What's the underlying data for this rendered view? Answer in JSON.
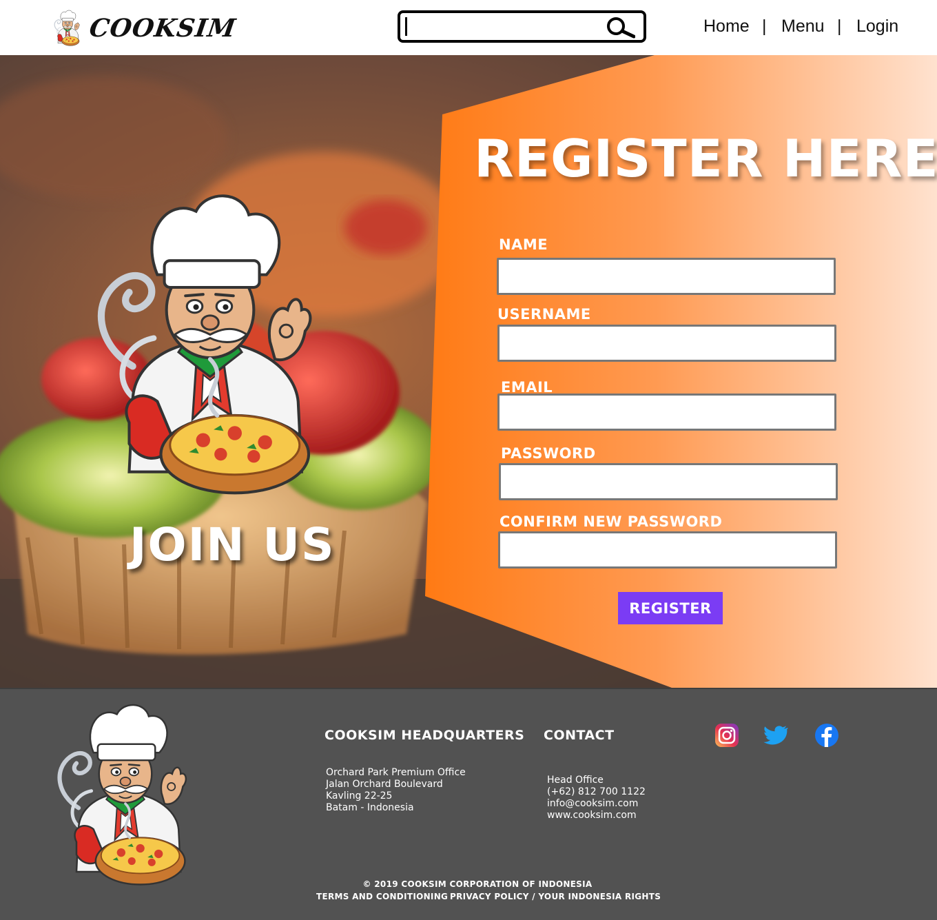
{
  "header": {
    "brand": "COOKSIM",
    "search": {
      "value": "",
      "placeholder": ""
    },
    "nav": [
      {
        "label": "Home"
      },
      {
        "label": "Menu"
      },
      {
        "label": "Login"
      }
    ],
    "separator": "|"
  },
  "hero": {
    "tagline": "JOIN US"
  },
  "form": {
    "title": "REGISTER HERE",
    "fields": [
      {
        "label": "NAME",
        "value": ""
      },
      {
        "label": "USERNAME",
        "value": ""
      },
      {
        "label": "EMAIL",
        "value": ""
      },
      {
        "label": "PASSWORD",
        "value": ""
      },
      {
        "label": "CONFIRM NEW PASSWORD",
        "value": ""
      }
    ],
    "submit_label": "REGISTER",
    "submit_color": "#7b3cf4"
  },
  "footer": {
    "headquarters": {
      "title": "COOKSIM HEADQUARTERS",
      "lines": [
        "Orchard Park Premium Office",
        "Jalan Orchard Boulevard",
        "Kavling 22-25",
        "Batam - Indonesia"
      ]
    },
    "contact": {
      "title": "CONTACT",
      "lines": [
        "Head Office",
        "(+62) 812 700 1122",
        "info@cooksim.com",
        "www.cooksim.com"
      ]
    },
    "social": [
      {
        "icon": "instagram-icon"
      },
      {
        "icon": "twitter-icon"
      },
      {
        "icon": "facebook-icon"
      }
    ],
    "copyright": "© 2019 COOKSIM CORPORATION OF INDONESIA",
    "links": [
      "TERMS AND CONDITIONING",
      "PRIVACY POLICY / YOUR INDONESIA RIGHTS"
    ]
  },
  "colors": {
    "panel_orange": "#ff7a1a",
    "footer_gray": "#525252"
  }
}
